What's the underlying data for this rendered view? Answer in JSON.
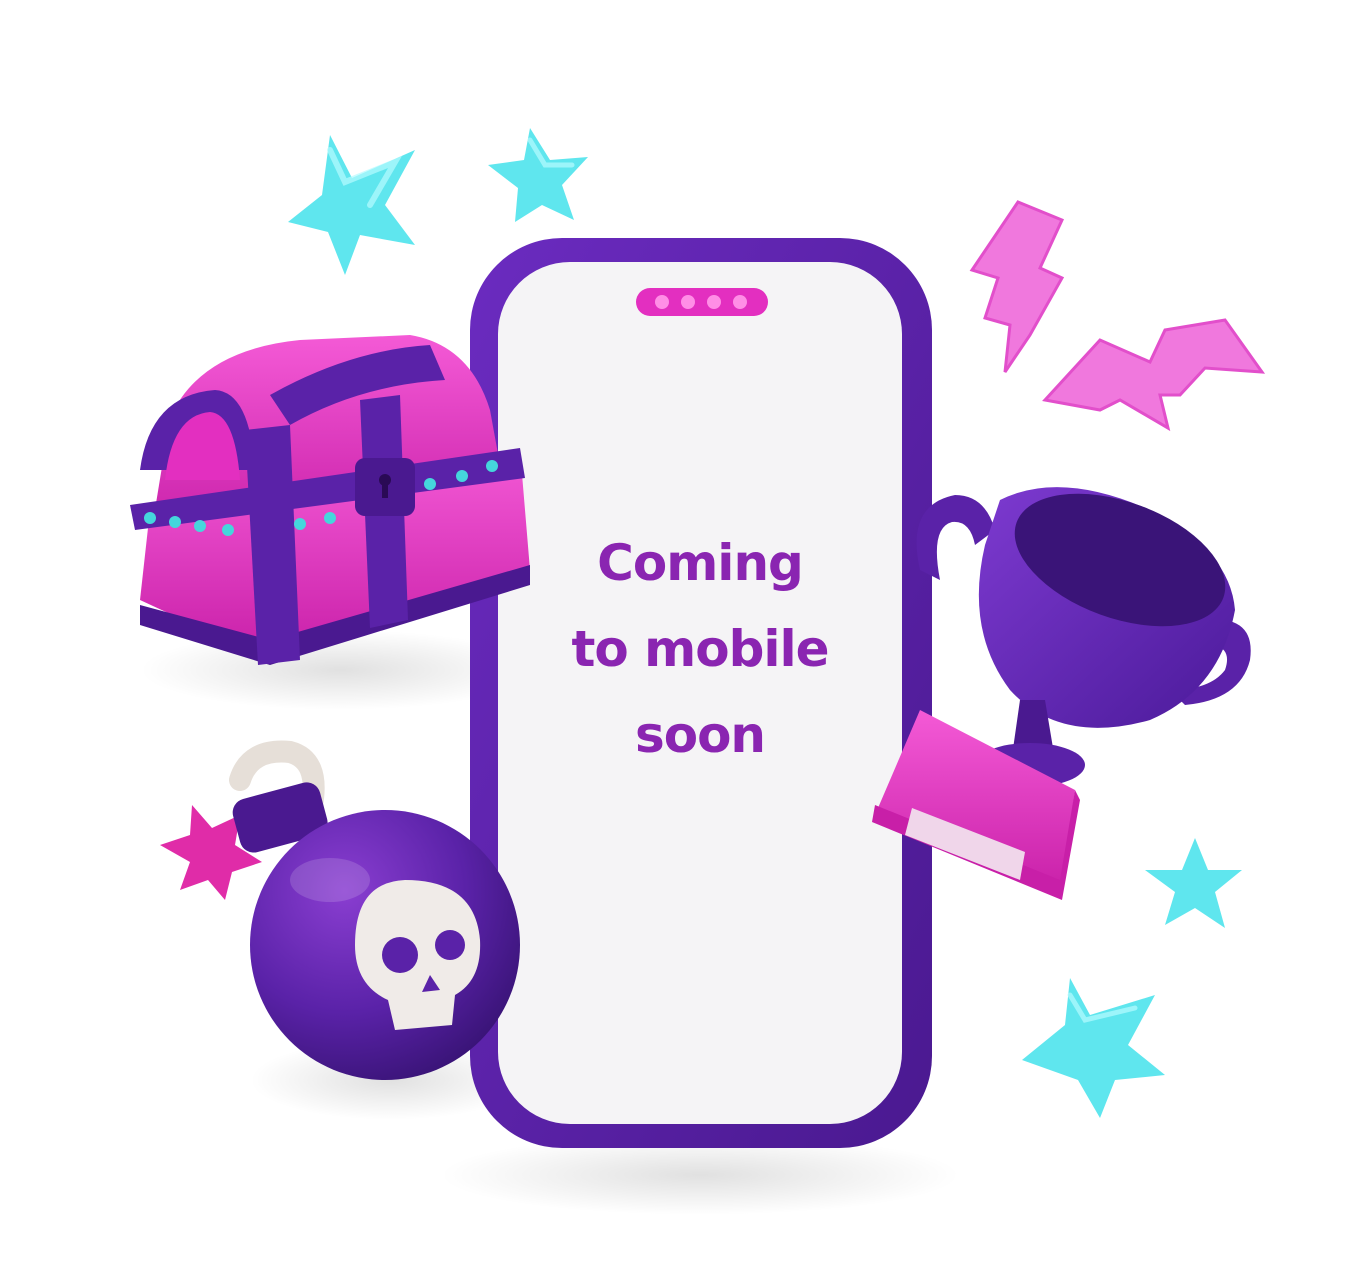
{
  "message": {
    "line1": "Coming",
    "line2": "to mobile",
    "line3": "soon"
  },
  "colors": {
    "text": "#8a25b1",
    "phone_frame": "#5b1fa6",
    "screen": "#f5f4f6",
    "pink": "#e32fc0",
    "cyan": "#5fe6ee",
    "purple": "#5a22a8"
  },
  "decorations": [
    "star-icon",
    "lightning-bolt-icon",
    "treasure-chest-icon",
    "trophy-icon",
    "bomb-icon",
    "skull-icon"
  ]
}
